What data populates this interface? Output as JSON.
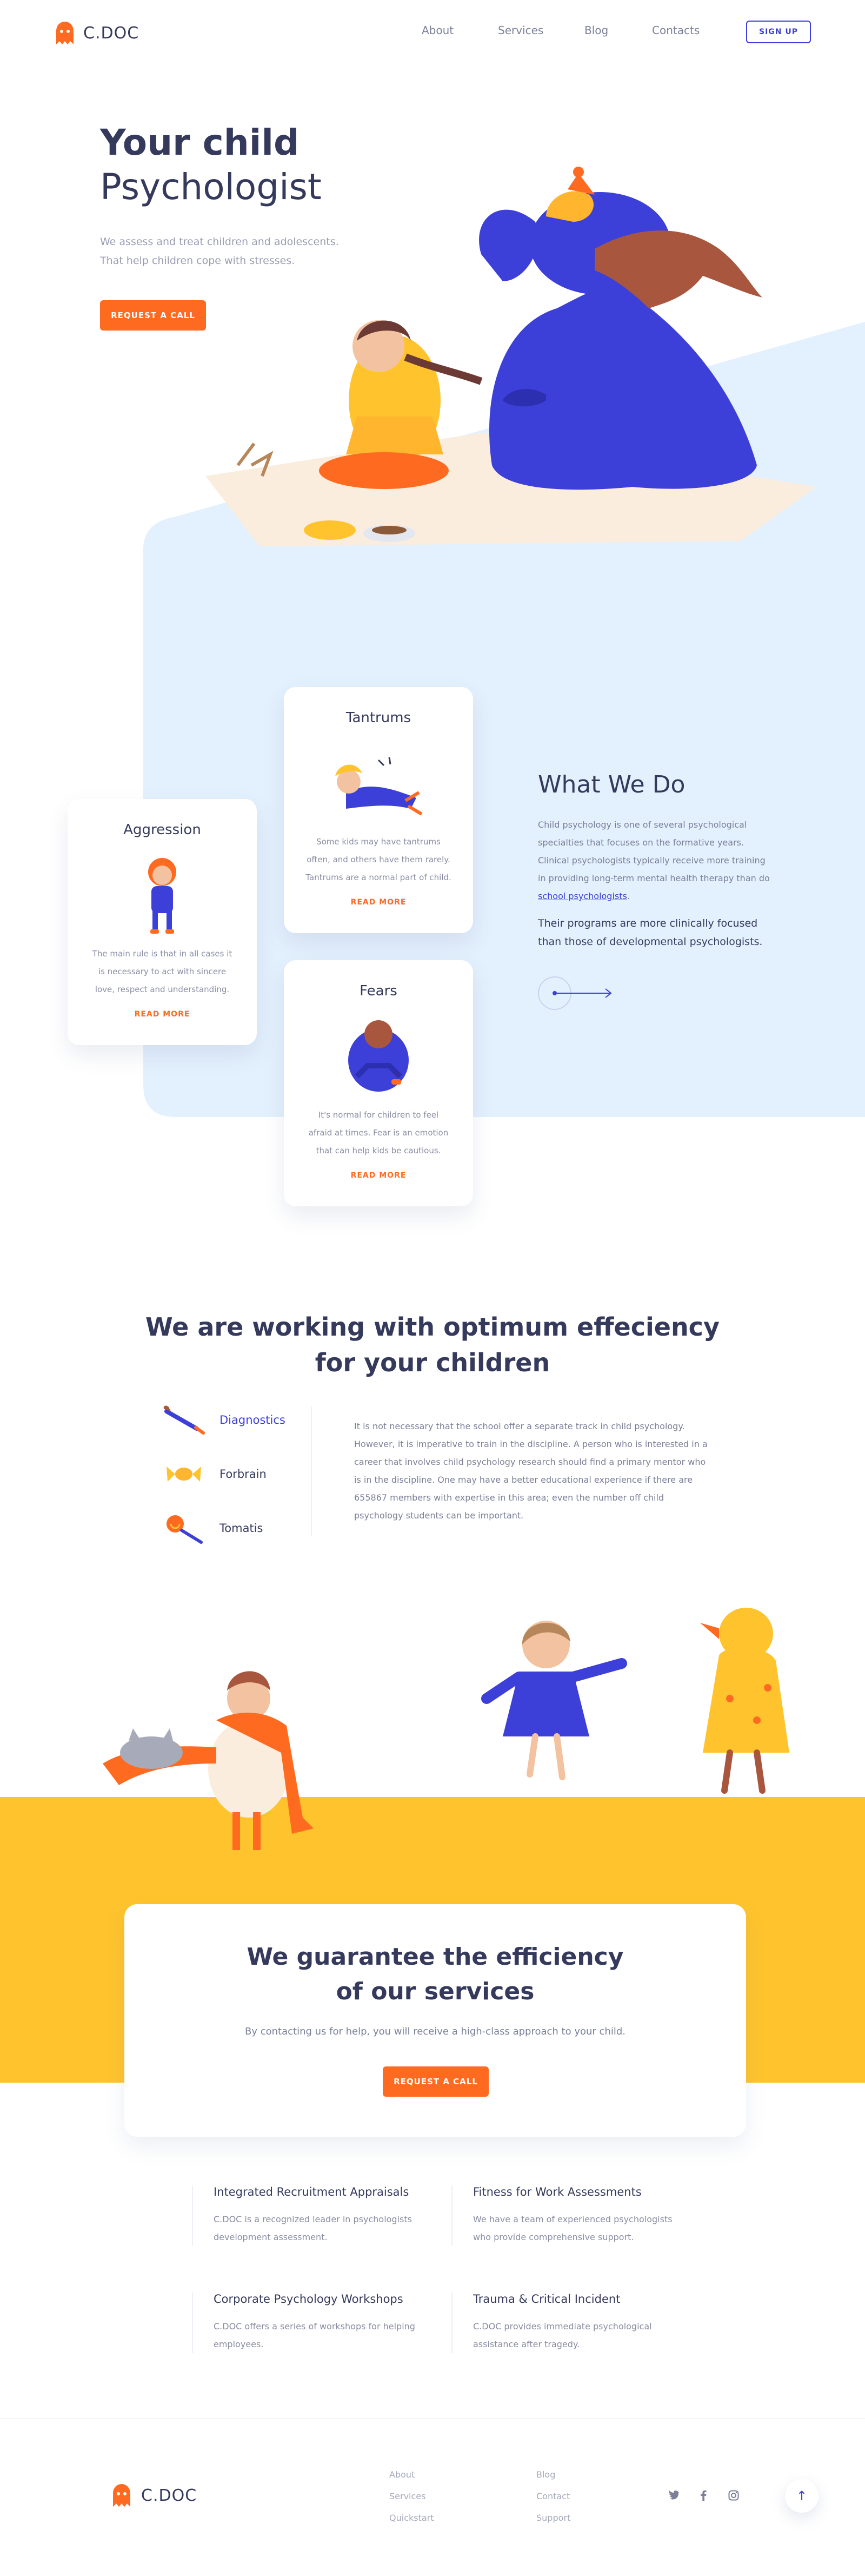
{
  "brand": {
    "name": "C.DOC",
    "accent": "#ff6a21",
    "primary": "#3c3fd8",
    "dark": "#353a5c",
    "yellow": "#ffc42d",
    "light_blue": "#e3f0fd"
  },
  "nav": {
    "items": [
      "About",
      "Services",
      "Blog",
      "Contacts"
    ],
    "signup": "SIGN UP"
  },
  "hero": {
    "title_bold": "Your child",
    "title_light": "Psychologist",
    "subtitle_1": "We assess and treat children and adolescents.",
    "subtitle_2": "That help children cope with stresses.",
    "cta": "REQUEST A CALL"
  },
  "cards": [
    {
      "title": "Tantrums",
      "text": "Some kids may have tantrums often, and others have them rarely. Tantrums are a normal part of child.",
      "link": "READ MORE"
    },
    {
      "title": "Aggression",
      "text": "The main rule is that in all cases it is necessary to act with sincere love, respect and understanding.",
      "link": "READ MORE"
    },
    {
      "title": "Fears",
      "text": "It's normal for children to feel afraid at times. Fear is an emotion that can help kids be cautious.",
      "link": "READ MORE"
    }
  ],
  "what_we_do": {
    "title": "What We Do",
    "p1_text": "Child psychology is one of several psychological specialties that focuses on the formative years. Clinical psychologists typically receive more training in providing long-term mental health therapy than do ",
    "p1_link": "school psychologists",
    "p1_end": ".",
    "p2": "Their programs are more clinically focused than those of developmental psychologists."
  },
  "efficiency": {
    "title_1": "We are working with optimum effeciency",
    "title_2": "for your children",
    "items": [
      {
        "label": "Diagnostics",
        "icon": "paintbrush-icon",
        "active": true
      },
      {
        "label": "Forbrain",
        "icon": "candy-icon",
        "active": false
      },
      {
        "label": "Tomatis",
        "icon": "lollipop-icon",
        "active": false
      }
    ],
    "text": "It is not necessary that the school offer a separate track in child psychology. However, it is imperative to train in the discipline. A person who is interested in a career that involves child psychology research should find a primary mentor who is in the discipline. One may have a better educational experience if there are 655867 members with expertise in this area; even the number off child psychology students can be important."
  },
  "guarantee": {
    "title_1": "We guarantee the efficiency",
    "title_2": "of our services",
    "subtitle": "By contacting us for help, you will receive a high-class approach to your child.",
    "cta": "REQUEST A CALL"
  },
  "services": [
    {
      "title": "Integrated Recruitment Appraisals",
      "text": "C.DOC is a recognized leader in psychologists development assessment."
    },
    {
      "title": "Fitness for Work Assessments",
      "text": "We have a team of experienced psychologists who provide comprehensive support."
    },
    {
      "title": "Corporate Psychology Workshops",
      "text": "C.DOC offers a series of workshops for helping employees."
    },
    {
      "title": "Trauma & Critical Incident",
      "text": "C.DOC provides immediate psychological assistance after tragedy."
    }
  ],
  "footer": {
    "col1": [
      "About",
      "Services",
      "Quickstart"
    ],
    "col2": [
      "Blog",
      "Contact",
      "Support"
    ],
    "social": [
      "twitter-icon",
      "facebook-icon",
      "instagram-icon"
    ],
    "to_top": "↑"
  }
}
